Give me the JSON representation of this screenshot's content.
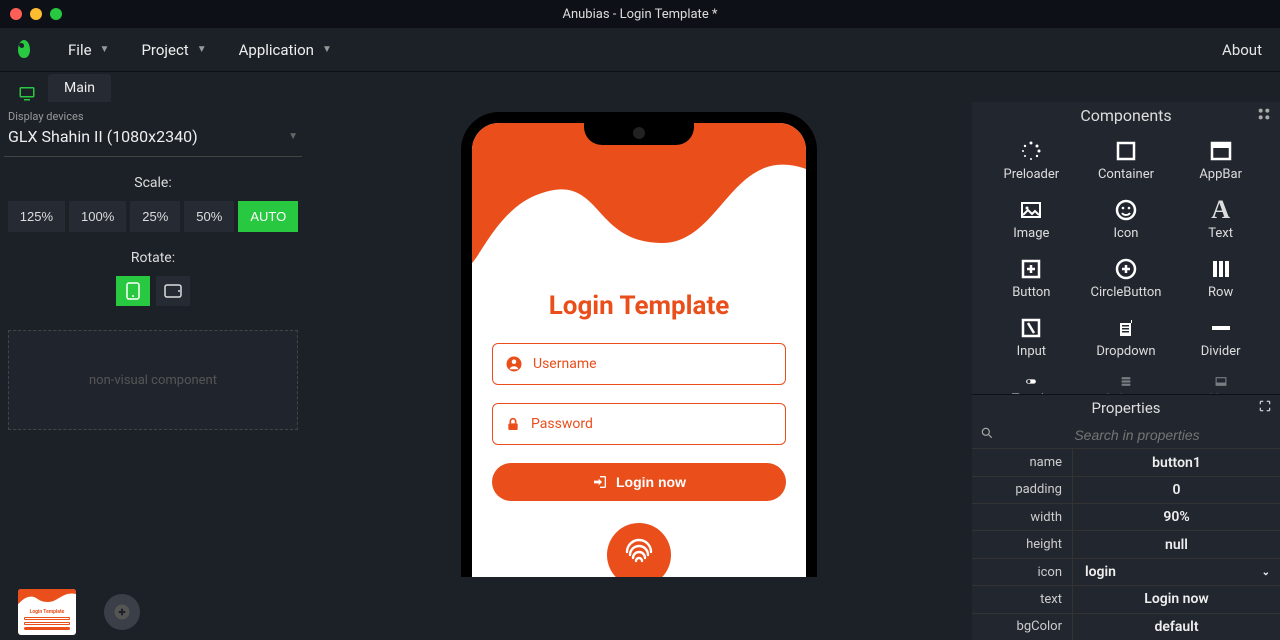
{
  "window": {
    "title": "Anubias - Login Template *"
  },
  "menubar": {
    "items": [
      {
        "label": "File"
      },
      {
        "label": "Project"
      },
      {
        "label": "Application"
      }
    ],
    "about": "About"
  },
  "tab": {
    "label": "Main"
  },
  "left": {
    "display_devices_label": "Display devices",
    "selected_device": "GLX Shahin II (1080x2340)",
    "scale_label": "Scale:",
    "scale_options": [
      "125%",
      "100%",
      "25%",
      "50%"
    ],
    "scale_auto": "AUTO",
    "rotate_label": "Rotate:",
    "nonvisual_label": "non-visual component"
  },
  "phone": {
    "title": "Login Template",
    "username_placeholder": "Username",
    "password_placeholder": "Password",
    "login_button": "Login now"
  },
  "components": {
    "header": "Components",
    "items": [
      {
        "label": "Preloader"
      },
      {
        "label": "Container"
      },
      {
        "label": "AppBar"
      },
      {
        "label": "Image"
      },
      {
        "label": "Icon"
      },
      {
        "label": "Text"
      },
      {
        "label": "Button"
      },
      {
        "label": "CircleButton"
      },
      {
        "label": "Row"
      },
      {
        "label": "Input"
      },
      {
        "label": "Dropdown"
      },
      {
        "label": "Divider"
      },
      {
        "label": "Toggle"
      },
      {
        "label": "Column"
      },
      {
        "label": "Nav"
      }
    ]
  },
  "properties": {
    "header": "Properties",
    "search_placeholder": "Search in properties",
    "rows": [
      {
        "label": "name",
        "value": "button1"
      },
      {
        "label": "padding",
        "value": "0"
      },
      {
        "label": "width",
        "value": "90%"
      },
      {
        "label": "height",
        "value": "null"
      },
      {
        "label": "icon",
        "value": "login",
        "dropdown": true
      },
      {
        "label": "text",
        "value": "Login now"
      },
      {
        "label": "bgColor",
        "value": "default"
      }
    ]
  },
  "accent": "#e94e1b",
  "green": "#28c840"
}
